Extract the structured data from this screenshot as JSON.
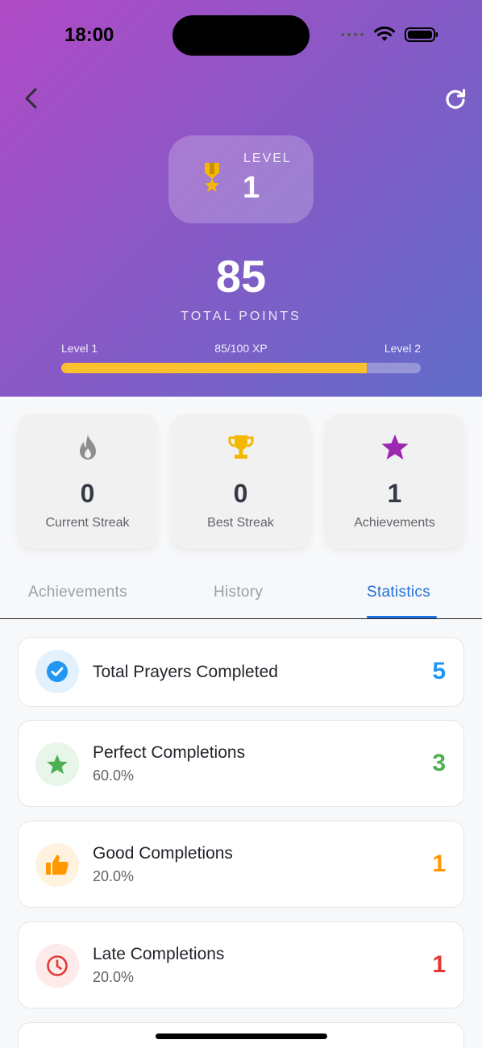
{
  "status_bar": {
    "time": "18:00"
  },
  "header": {
    "level_caption": "LEVEL",
    "level_value": "1",
    "total_points": "85",
    "total_label": "TOTAL POINTS",
    "xp": {
      "left_label": "Level 1",
      "progress_text": "85/100 XP",
      "right_label": "Level 2",
      "progress_fraction": 0.85,
      "fill_color": "#fbc02d"
    }
  },
  "stats": [
    {
      "icon": "flame-icon",
      "value": "0",
      "label": "Current Streak",
      "color": "#8e8e8e"
    },
    {
      "icon": "trophy-icon",
      "value": "0",
      "label": "Best Streak",
      "color": "#f5b800"
    },
    {
      "icon": "star-icon",
      "value": "1",
      "label": "Achievements",
      "color": "#9c27b0"
    }
  ],
  "tabs": [
    {
      "label": "Achievements",
      "active": false
    },
    {
      "label": "History",
      "active": false
    },
    {
      "label": "Statistics",
      "active": true
    }
  ],
  "statistics": [
    {
      "icon": "check-circle-icon",
      "title": "Total Prayers Completed",
      "subtitle": "",
      "count": "5",
      "color": "#2196f3"
    },
    {
      "icon": "star-icon",
      "title": "Perfect Completions",
      "subtitle": "60.0%",
      "count": "3",
      "color": "#4caf50"
    },
    {
      "icon": "thumbs-up-icon",
      "title": "Good Completions",
      "subtitle": "20.0%",
      "count": "1",
      "color": "#ff9800"
    },
    {
      "icon": "clock-icon",
      "title": "Late Completions",
      "subtitle": "20.0%",
      "count": "1",
      "color": "#e53935"
    }
  ]
}
